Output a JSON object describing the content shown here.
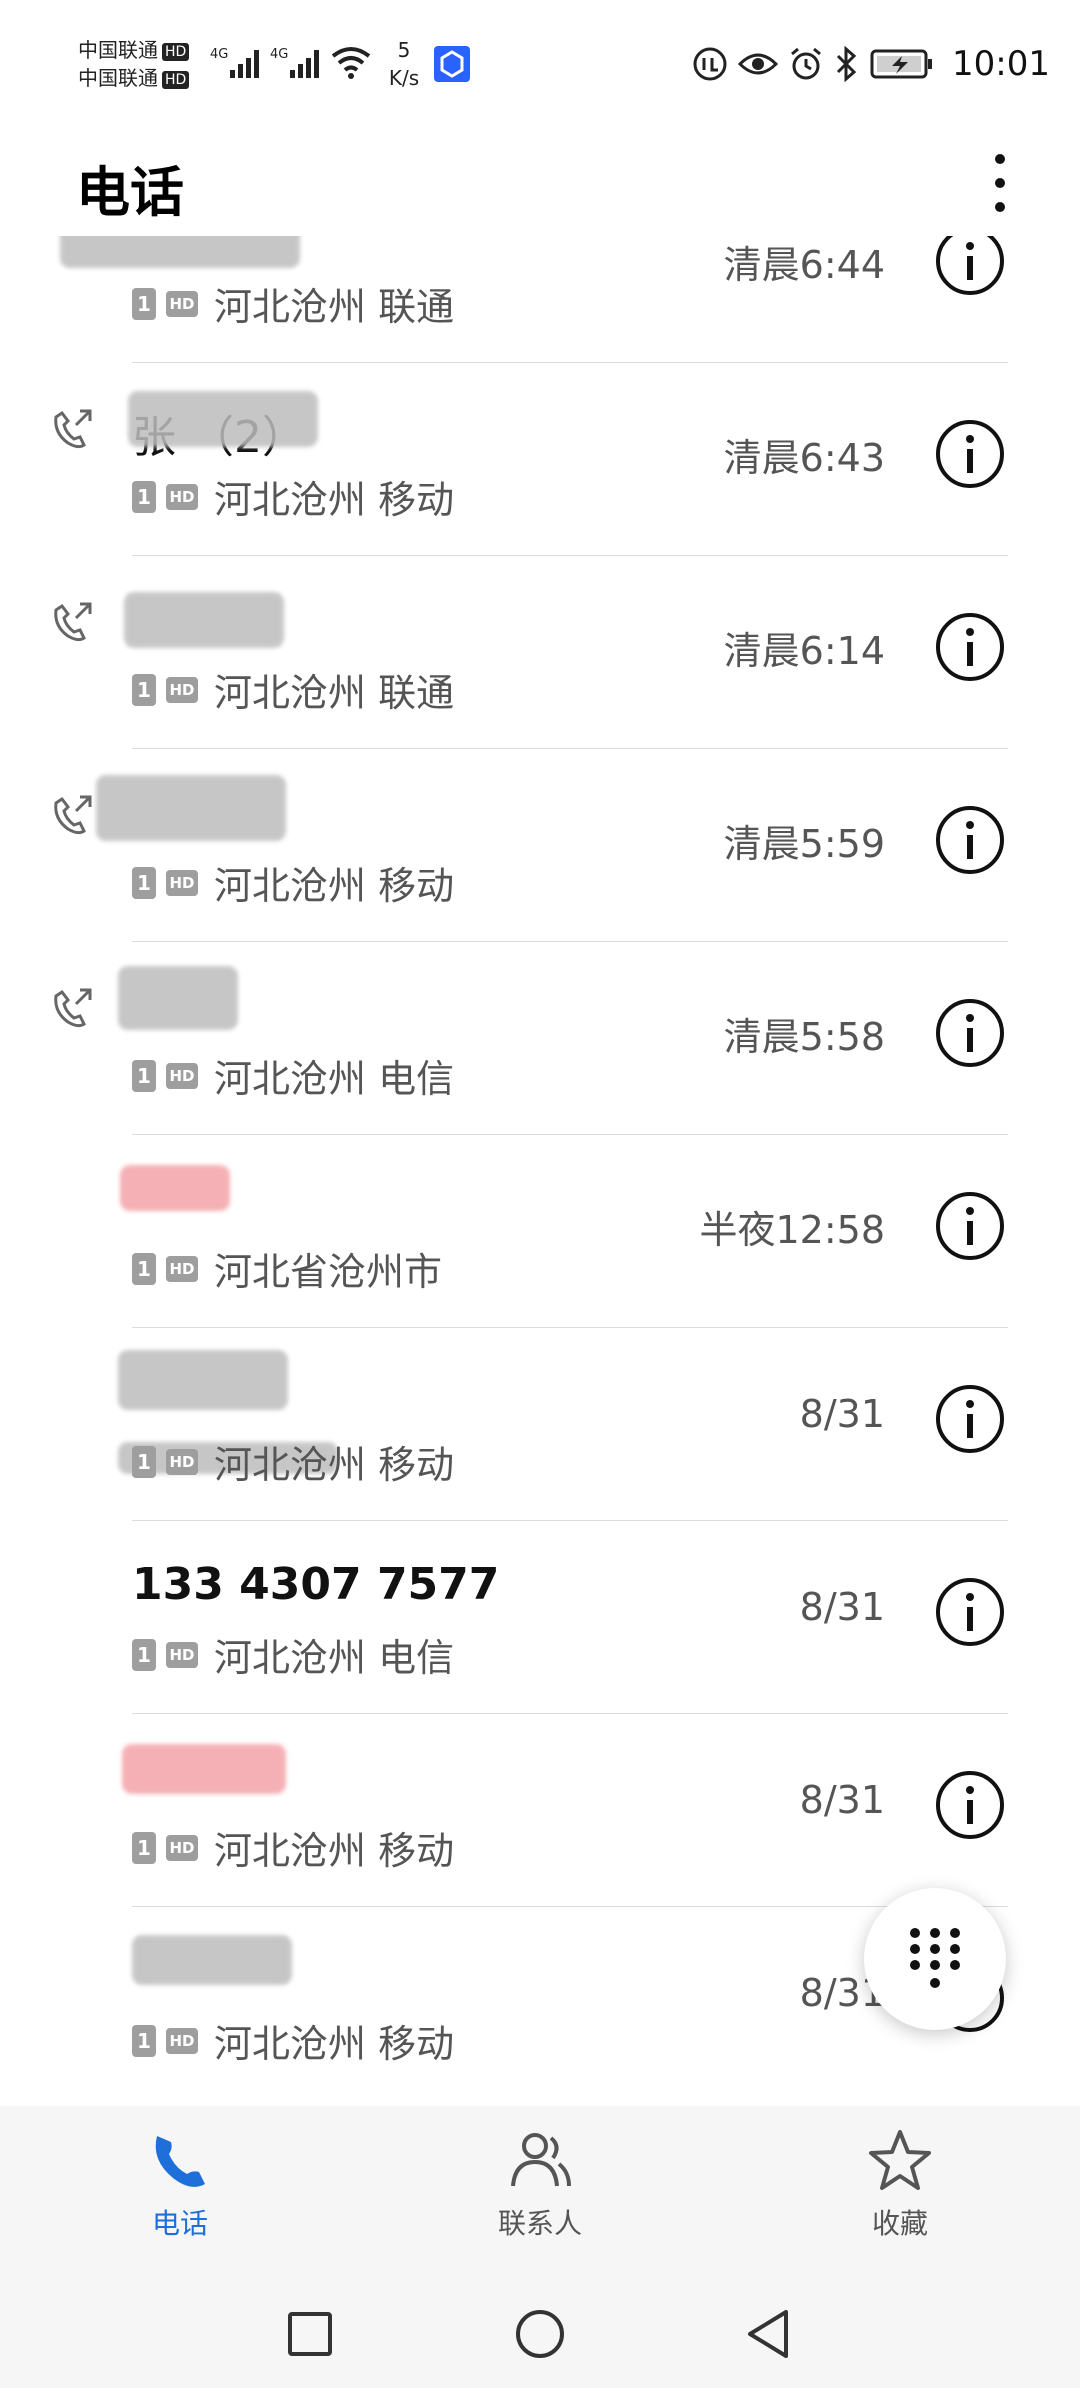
{
  "status_bar": {
    "carrier1": "中国联通",
    "carrier2": "中国联通",
    "hd_label": "HD",
    "net_type1": "4G",
    "net_type2": "4G",
    "net_speed_value": "5",
    "net_speed_unit": "K/s",
    "time": "10:01"
  },
  "header": {
    "title": "电话"
  },
  "calls": [
    {
      "name": "",
      "redacted": true,
      "sim": "1",
      "hd": "HD",
      "location": "河北沧州 联通",
      "time": "清晨6:44",
      "type": "outgoing",
      "missed": false
    },
    {
      "name": "张  （2）",
      "redacted": true,
      "sim": "1",
      "hd": "HD",
      "location": "河北沧州 移动",
      "time": "清晨6:43",
      "type": "outgoing",
      "missed": false
    },
    {
      "name": "",
      "redacted": true,
      "sim": "1",
      "hd": "HD",
      "location": "河北沧州 联通",
      "time": "清晨6:14",
      "type": "outgoing",
      "missed": false
    },
    {
      "name": "",
      "redacted": true,
      "sim": "1",
      "hd": "HD",
      "location": "河北沧州 移动",
      "time": "清晨5:59",
      "type": "outgoing",
      "missed": false
    },
    {
      "name": "",
      "redacted": true,
      "sim": "1",
      "hd": "HD",
      "location": "河北沧州 电信",
      "time": "清晨5:58",
      "type": "outgoing",
      "missed": false
    },
    {
      "name": "",
      "redacted": true,
      "sim": "1",
      "hd": "HD",
      "location": "河北省沧州市",
      "time": "半夜12:58",
      "type": "incoming",
      "missed": true
    },
    {
      "name": "",
      "redacted": true,
      "sim": "1",
      "hd": "HD",
      "location": "河北沧州 移动",
      "time": "8/31",
      "type": "incoming",
      "missed": false
    },
    {
      "name": "133 4307 7577",
      "redacted": false,
      "sim": "1",
      "hd": "HD",
      "location": "河北沧州 电信",
      "time": "8/31",
      "type": "incoming",
      "missed": false
    },
    {
      "name": "",
      "redacted": true,
      "sim": "1",
      "hd": "HD",
      "location": "河北沧州 移动",
      "time": "8/31",
      "type": "incoming",
      "missed": true
    },
    {
      "name": "",
      "redacted": true,
      "sim": "1",
      "hd": "HD",
      "location": "河北沧州 移动",
      "time": "8/31",
      "type": "incoming",
      "missed": false
    }
  ],
  "bottom_nav": {
    "items": [
      {
        "label": "电话",
        "icon": "phone-icon",
        "active": true
      },
      {
        "label": "联系人",
        "icon": "contacts-icon",
        "active": false
      },
      {
        "label": "收藏",
        "icon": "star-icon",
        "active": false
      }
    ]
  },
  "colors": {
    "accent": "#1e6fd9",
    "missed": "#e53935",
    "secondary_text": "#555555"
  }
}
